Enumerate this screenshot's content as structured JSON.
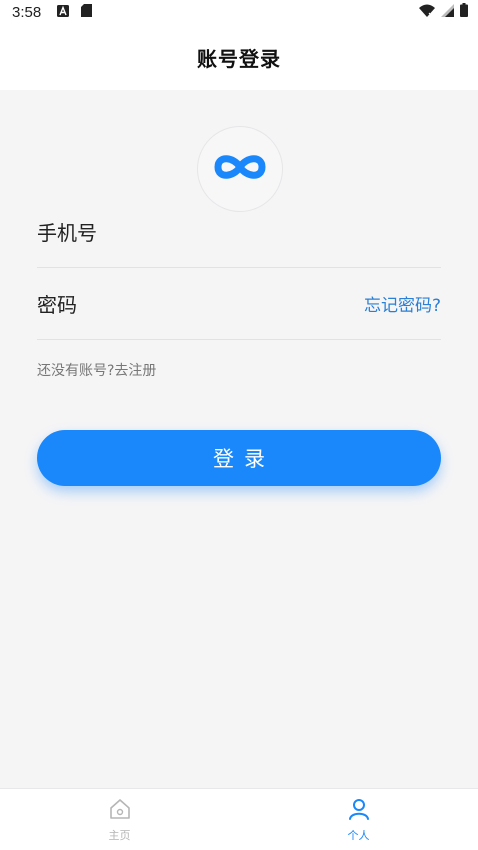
{
  "status_bar": {
    "time": "3:58"
  },
  "header": {
    "title": "账号登录"
  },
  "logo": {
    "icon": "infinity-logo-icon"
  },
  "form": {
    "phone_label": "手机号",
    "password_label": "密码",
    "forgot_password": "忘记密码?",
    "register_prompt": "还没有账号?去注册",
    "login_button": "登录"
  },
  "tabbar": {
    "items": [
      {
        "label": "主页",
        "icon": "home-icon",
        "active": false
      },
      {
        "label": "个人",
        "icon": "user-icon",
        "active": true
      }
    ]
  },
  "colors": {
    "accent": "#1a88fb",
    "link": "#2a7fd6",
    "background": "#f5f5f6"
  }
}
